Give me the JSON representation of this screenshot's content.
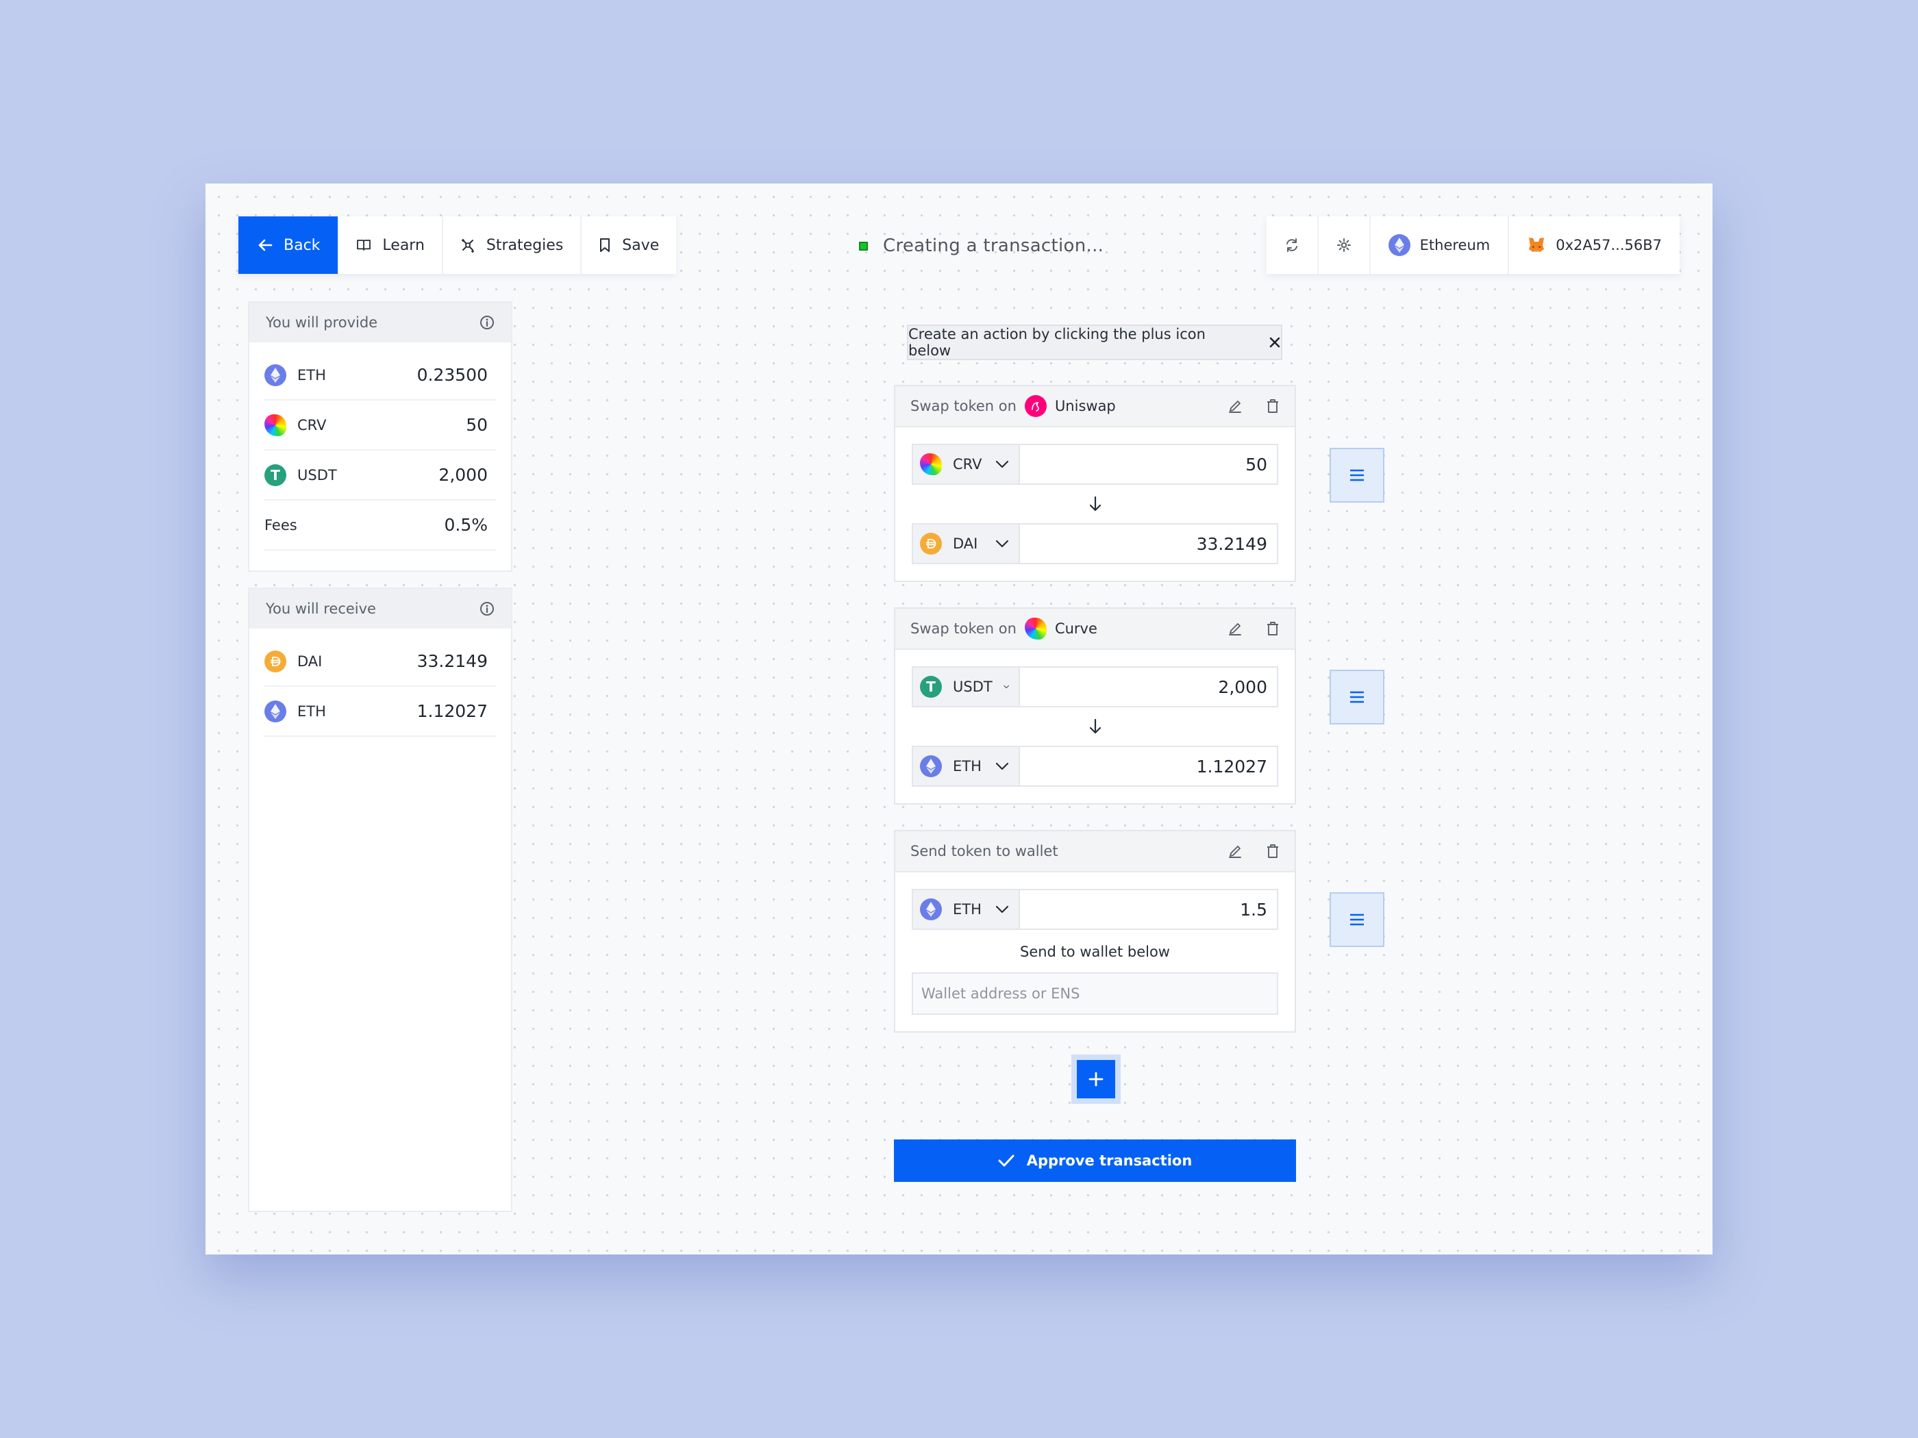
{
  "nav": {
    "back_label": "Back",
    "learn_label": "Learn",
    "strategies_label": "Strategies",
    "save_label": "Save"
  },
  "status": {
    "text": "Creating a transaction...",
    "color": "#19c32a"
  },
  "topright": {
    "refresh_icon": "refresh-icon",
    "settings_icon": "gear-icon",
    "network_label": "Ethereum",
    "wallet_label": "0x2A57...56B7"
  },
  "provide": {
    "title": "You will provide",
    "rows": [
      {
        "token": "ETH",
        "value": "0.23500"
      },
      {
        "token": "CRV",
        "value": "50"
      },
      {
        "token": "USDT",
        "value": "2,000"
      }
    ],
    "fees_label": "Fees",
    "fees_value": "0.5%"
  },
  "receive": {
    "title": "You will receive",
    "rows": [
      {
        "token": "DAI",
        "value": "33.2149"
      },
      {
        "token": "ETH",
        "value": "1.12027"
      }
    ]
  },
  "banner": {
    "text": "Create an action by clicking the plus icon below"
  },
  "actions": [
    {
      "title": "Swap token on",
      "protocol": "Uniswap",
      "from": {
        "token": "CRV",
        "amount": "50"
      },
      "to": {
        "token": "DAI",
        "amount": "33.2149"
      }
    },
    {
      "title": "Swap token on",
      "protocol": "Curve",
      "from": {
        "token": "USDT",
        "amount": "2,000"
      },
      "to": {
        "token": "ETH",
        "amount": "1.12027"
      }
    },
    {
      "title": "Send token to wallet",
      "from": {
        "token": "ETH",
        "amount": "1.5"
      },
      "send_label": "Send to wallet below",
      "wallet_placeholder": "Wallet address or ENS"
    }
  ],
  "approve_label": "Approve transaction",
  "colors": {
    "accent": "#0561f5",
    "background": "#bfccee",
    "eth": "#6a7de8",
    "usdt": "#26a17b",
    "dai": "#f5ac37",
    "uniswap": "#ff007a"
  }
}
